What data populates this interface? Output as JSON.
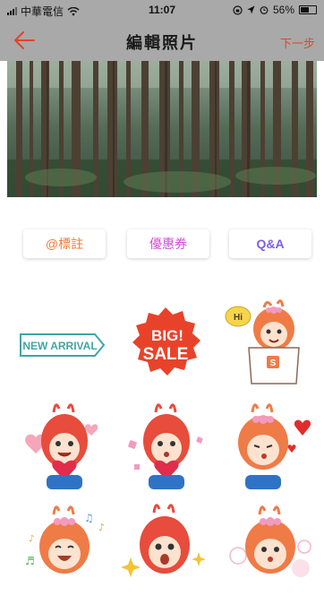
{
  "status": {
    "carrier": "中華電信",
    "time": "11:07",
    "battery": "56%",
    "battery_level": 0.56
  },
  "nav": {
    "title": "編輯照片",
    "next_label": "下一步"
  },
  "tabs": [
    {
      "label": "@標註"
    },
    {
      "label": "優惠券"
    },
    {
      "label": "Q&A"
    }
  ],
  "stickers": {
    "new_arrival": "NEW ARRIVAL",
    "big_sale_line1": "BIG!",
    "big_sale_line2": "SALE",
    "hi": "Hi",
    "bag_letter": "S"
  },
  "colors": {
    "accent": "#e0452a",
    "bar": "#a9a9a9",
    "teal": "#3fa7a4",
    "mascot_orange": "#ef7b47",
    "mascot_red": "#e74c3c"
  }
}
